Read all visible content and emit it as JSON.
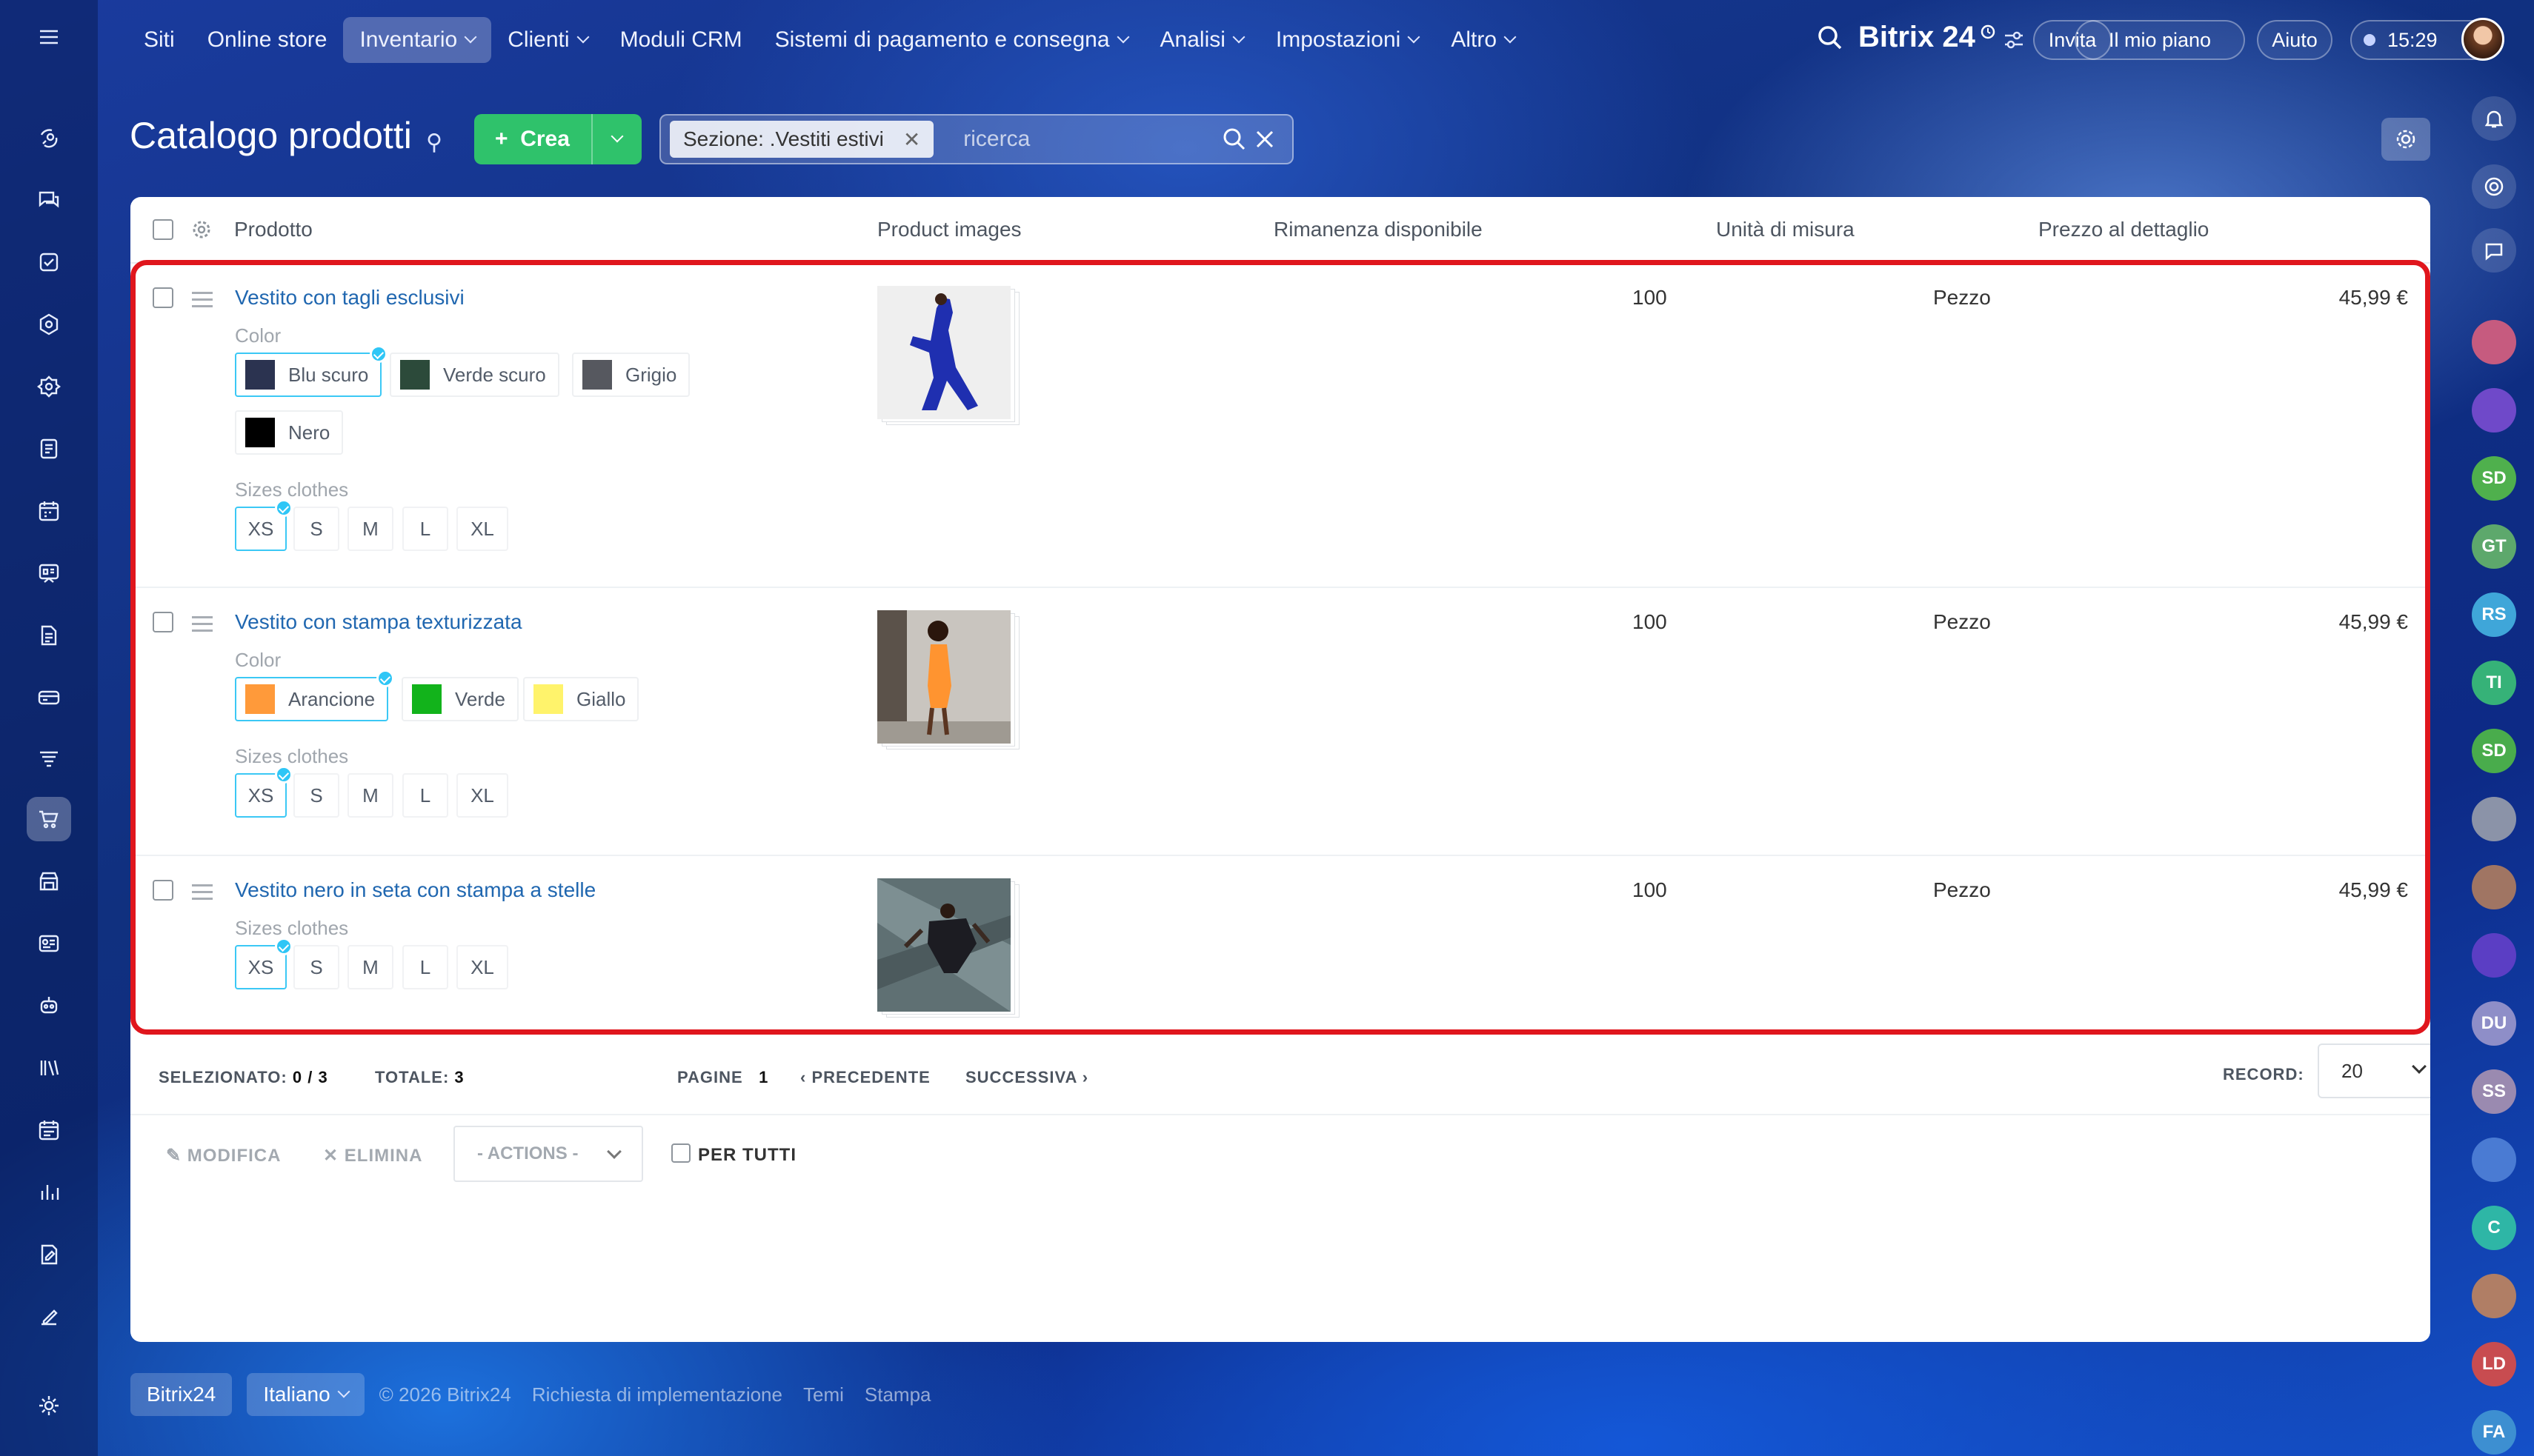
{
  "topnav": {
    "items": [
      "Siti",
      "Online store",
      "Inventario",
      "Clienti",
      "Moduli CRM",
      "Sistemi di pagamento e consegna",
      "Analisi",
      "Impostazioni",
      "Altro"
    ],
    "brand": "Bitrix 24",
    "invite": "Invita",
    "plan": "Il mio piano",
    "help": "Aiuto",
    "time": "15:29"
  },
  "page": {
    "title": "Catalogo prodotti",
    "create_label": "Crea",
    "filter_chip": "Sezione: .Vestiti estivi",
    "search_placeholder": "ricerca"
  },
  "table": {
    "headers": [
      "Prodotto",
      "Product images",
      "Rimanenza disponibile",
      "Unità di misura",
      "Prezzo al dettaglio"
    ],
    "rows": [
      {
        "name": "Vestito con tagli esclusivi",
        "color_label": "Color",
        "colors": [
          {
            "label": "Blu scuro",
            "swatch": "#2b3350",
            "selected": true
          },
          {
            "label": "Verde scuro",
            "swatch": "#2c4a3a",
            "selected": false
          },
          {
            "label": "Grigio",
            "swatch": "#56585f",
            "selected": false
          },
          {
            "label": "Nero",
            "swatch": "#000000",
            "selected": false
          }
        ],
        "size_label": "Sizes clothes",
        "sizes": [
          "XS",
          "S",
          "M",
          "L",
          "XL"
        ],
        "stock": "100",
        "unit": "Pezzo",
        "price": "45,99 €"
      },
      {
        "name": "Vestito con stampa texturizzata",
        "color_label": "Color",
        "colors": [
          {
            "label": "Arancione",
            "swatch": "#ff9a3a",
            "selected": true
          },
          {
            "label": "Verde",
            "swatch": "#12b31b",
            "selected": false
          },
          {
            "label": "Giallo",
            "swatch": "#fff36b",
            "selected": false
          }
        ],
        "size_label": "Sizes clothes",
        "sizes": [
          "XS",
          "S",
          "M",
          "L",
          "XL"
        ],
        "stock": "100",
        "unit": "Pezzo",
        "price": "45,99 €"
      },
      {
        "name": "Vestito nero in seta con stampa a stelle",
        "size_label": "Sizes clothes",
        "sizes": [
          "XS",
          "S",
          "M",
          "L",
          "XL"
        ],
        "stock": "100",
        "unit": "Pezzo",
        "price": "45,99 €"
      }
    ]
  },
  "pager": {
    "selected_label": "SELEZIONATO:",
    "selected_value": "0 / 3",
    "total_label": "TOTALE:",
    "total_value": "3",
    "pages_label": "PAGINE",
    "page": "1",
    "prev": "PRECEDENTE",
    "next": "SUCCESSIVA",
    "records_label": "RECORD:",
    "records_value": "20"
  },
  "actions": {
    "edit": "MODIFICA",
    "delete": "ELIMINA",
    "actions_select": "- ACTIONS -",
    "for_all": "PER TUTTI"
  },
  "footer": {
    "brand": "Bitrix24",
    "language": "Italiano",
    "copyright": "© 2026 Bitrix24",
    "impl": "Richiesta di implementazione",
    "themes": "Temi",
    "print": "Stampa"
  },
  "rightbar": {
    "avatars": [
      "SD",
      "GT",
      "RS",
      "TI",
      "SD",
      "DU",
      "SS",
      "C",
      "LD",
      "FA"
    ]
  }
}
